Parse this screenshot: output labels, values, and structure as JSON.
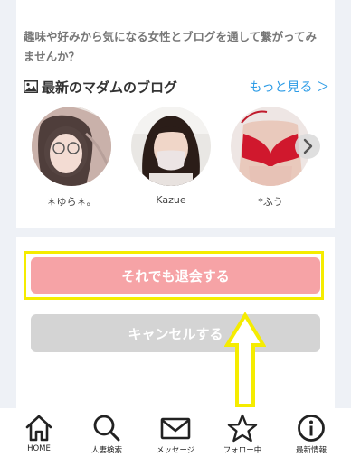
{
  "intro": {
    "text": "趣味や好みから気になる女性とブログを通して繋がってみませんか？"
  },
  "blog": {
    "icon": "image-icon",
    "title": "最新のマダムのブログ",
    "more_link": "もっと見る ＞",
    "authors": [
      {
        "name": "＊ゆら＊。"
      },
      {
        "name": "Kazue"
      },
      {
        "name": "*ふう"
      }
    ],
    "next_icon": "chevron-right-icon"
  },
  "actions": {
    "withdraw_label": "それでも退会する",
    "cancel_label": "キャンセルする",
    "highlight_color": "#f5ec00",
    "withdraw_color": "#f6a3a6",
    "cancel_color": "#d4d4d4"
  },
  "nav": {
    "items": [
      {
        "label": "HOME",
        "icon": "home-icon"
      },
      {
        "label": "人妻検索",
        "icon": "search-icon"
      },
      {
        "label": "メッセージ",
        "icon": "mail-icon"
      },
      {
        "label": "フォロー中",
        "icon": "star-icon"
      },
      {
        "label": "最新情報",
        "icon": "info-icon"
      }
    ]
  }
}
